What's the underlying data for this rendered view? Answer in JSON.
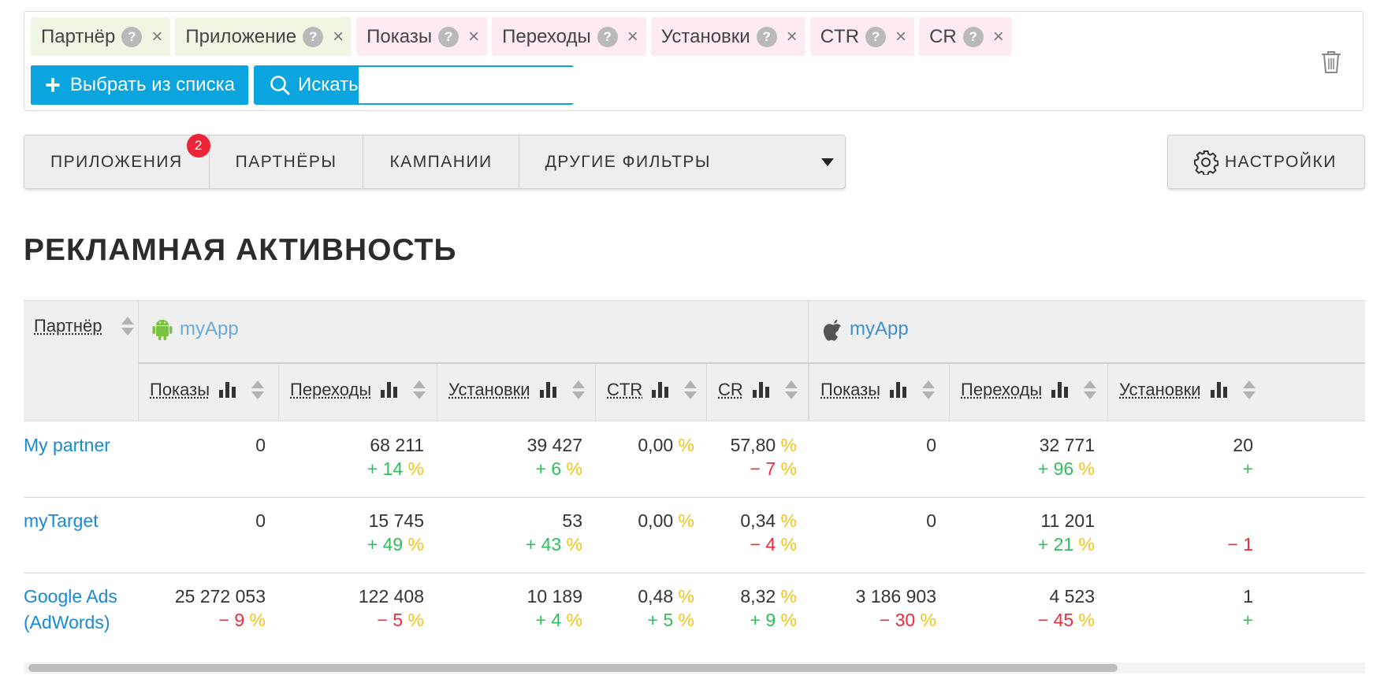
{
  "filters": {
    "chips": [
      {
        "label": "Партнёр",
        "group": "dimension"
      },
      {
        "label": "Приложение",
        "group": "dimension"
      },
      {
        "label": "Показы",
        "group": "metric"
      },
      {
        "label": "Переходы",
        "group": "metric"
      },
      {
        "label": "Установки",
        "group": "metric"
      },
      {
        "label": "CTR",
        "group": "metric"
      },
      {
        "label": "CR",
        "group": "metric"
      }
    ],
    "help_glyph": "?",
    "remove_glyph": "×",
    "pick_button": "Выбрать из списка",
    "search_button": "Искать",
    "search_value": ""
  },
  "tabs": {
    "apps": "ПРИЛОЖЕНИЯ",
    "apps_badge": "2",
    "partners": "ПАРТНЁРЫ",
    "campaigns": "КАМПАНИИ",
    "other": "ДРУГИЕ ФИЛЬТРЫ",
    "settings": "НАСТРОЙКИ"
  },
  "page_title": "РЕКЛАМНАЯ АКТИВНОСТЬ",
  "table": {
    "partner_header": "Партнёр",
    "apps": [
      {
        "name": "myApp",
        "platform": "android-icon"
      },
      {
        "name": "myApp",
        "platform": "apple-icon"
      }
    ],
    "columns": [
      "Показы",
      "Переходы",
      "Установки",
      "CTR",
      "CR",
      "Показы",
      "Переходы",
      "Установки"
    ],
    "rows": [
      {
        "partner": "My partner",
        "cells": [
          {
            "v": "0",
            "c": ""
          },
          {
            "v": "68 211",
            "c": "+ 14"
          },
          {
            "v": "39 427",
            "c": "+ 6"
          },
          {
            "v": "0,00",
            "pct": true,
            "c": ""
          },
          {
            "v": "57,80",
            "pct": true,
            "c": "− 7"
          },
          {
            "v": "0",
            "c": ""
          },
          {
            "v": "32 771",
            "c": "+ 96"
          },
          {
            "v": "20",
            "c": "+"
          }
        ]
      },
      {
        "partner": "myTarget",
        "cells": [
          {
            "v": "0",
            "c": ""
          },
          {
            "v": "15 745",
            "c": "+ 49"
          },
          {
            "v": "53",
            "c": "+ 43"
          },
          {
            "v": "0,00",
            "pct": true,
            "c": ""
          },
          {
            "v": "0,34",
            "pct": true,
            "c": "− 4"
          },
          {
            "v": "0",
            "c": ""
          },
          {
            "v": "11 201",
            "c": "+ 21"
          },
          {
            "v": "",
            "c": "− 1"
          }
        ]
      },
      {
        "partner": "Google Ads (AdWords)",
        "cells": [
          {
            "v": "25 272 053",
            "c": "− 9"
          },
          {
            "v": "122 408",
            "c": "− 5"
          },
          {
            "v": "10 189",
            "c": "+ 4"
          },
          {
            "v": "0,48",
            "pct": true,
            "c": "+ 5"
          },
          {
            "v": "8,32",
            "pct": true,
            "c": "+ 9"
          },
          {
            "v": "3 186 903",
            "c": "− 30"
          },
          {
            "v": "4 523",
            "c": "− 45"
          },
          {
            "v": "1",
            "c": "+"
          }
        ]
      }
    ]
  },
  "colors": {
    "accent": "#0aa5df",
    "link": "#1a8ad0",
    "positive": "#2fbe5b",
    "negative": "#ee2b3f",
    "percent": "#f2c515",
    "badge": "#ee2438"
  },
  "icons": [
    "help-icon",
    "close-icon",
    "plus-icon",
    "search-icon",
    "trash-icon",
    "gear-icon",
    "chevron-down-icon",
    "sort-icon",
    "bar-chart-icon",
    "android-icon",
    "apple-icon"
  ]
}
